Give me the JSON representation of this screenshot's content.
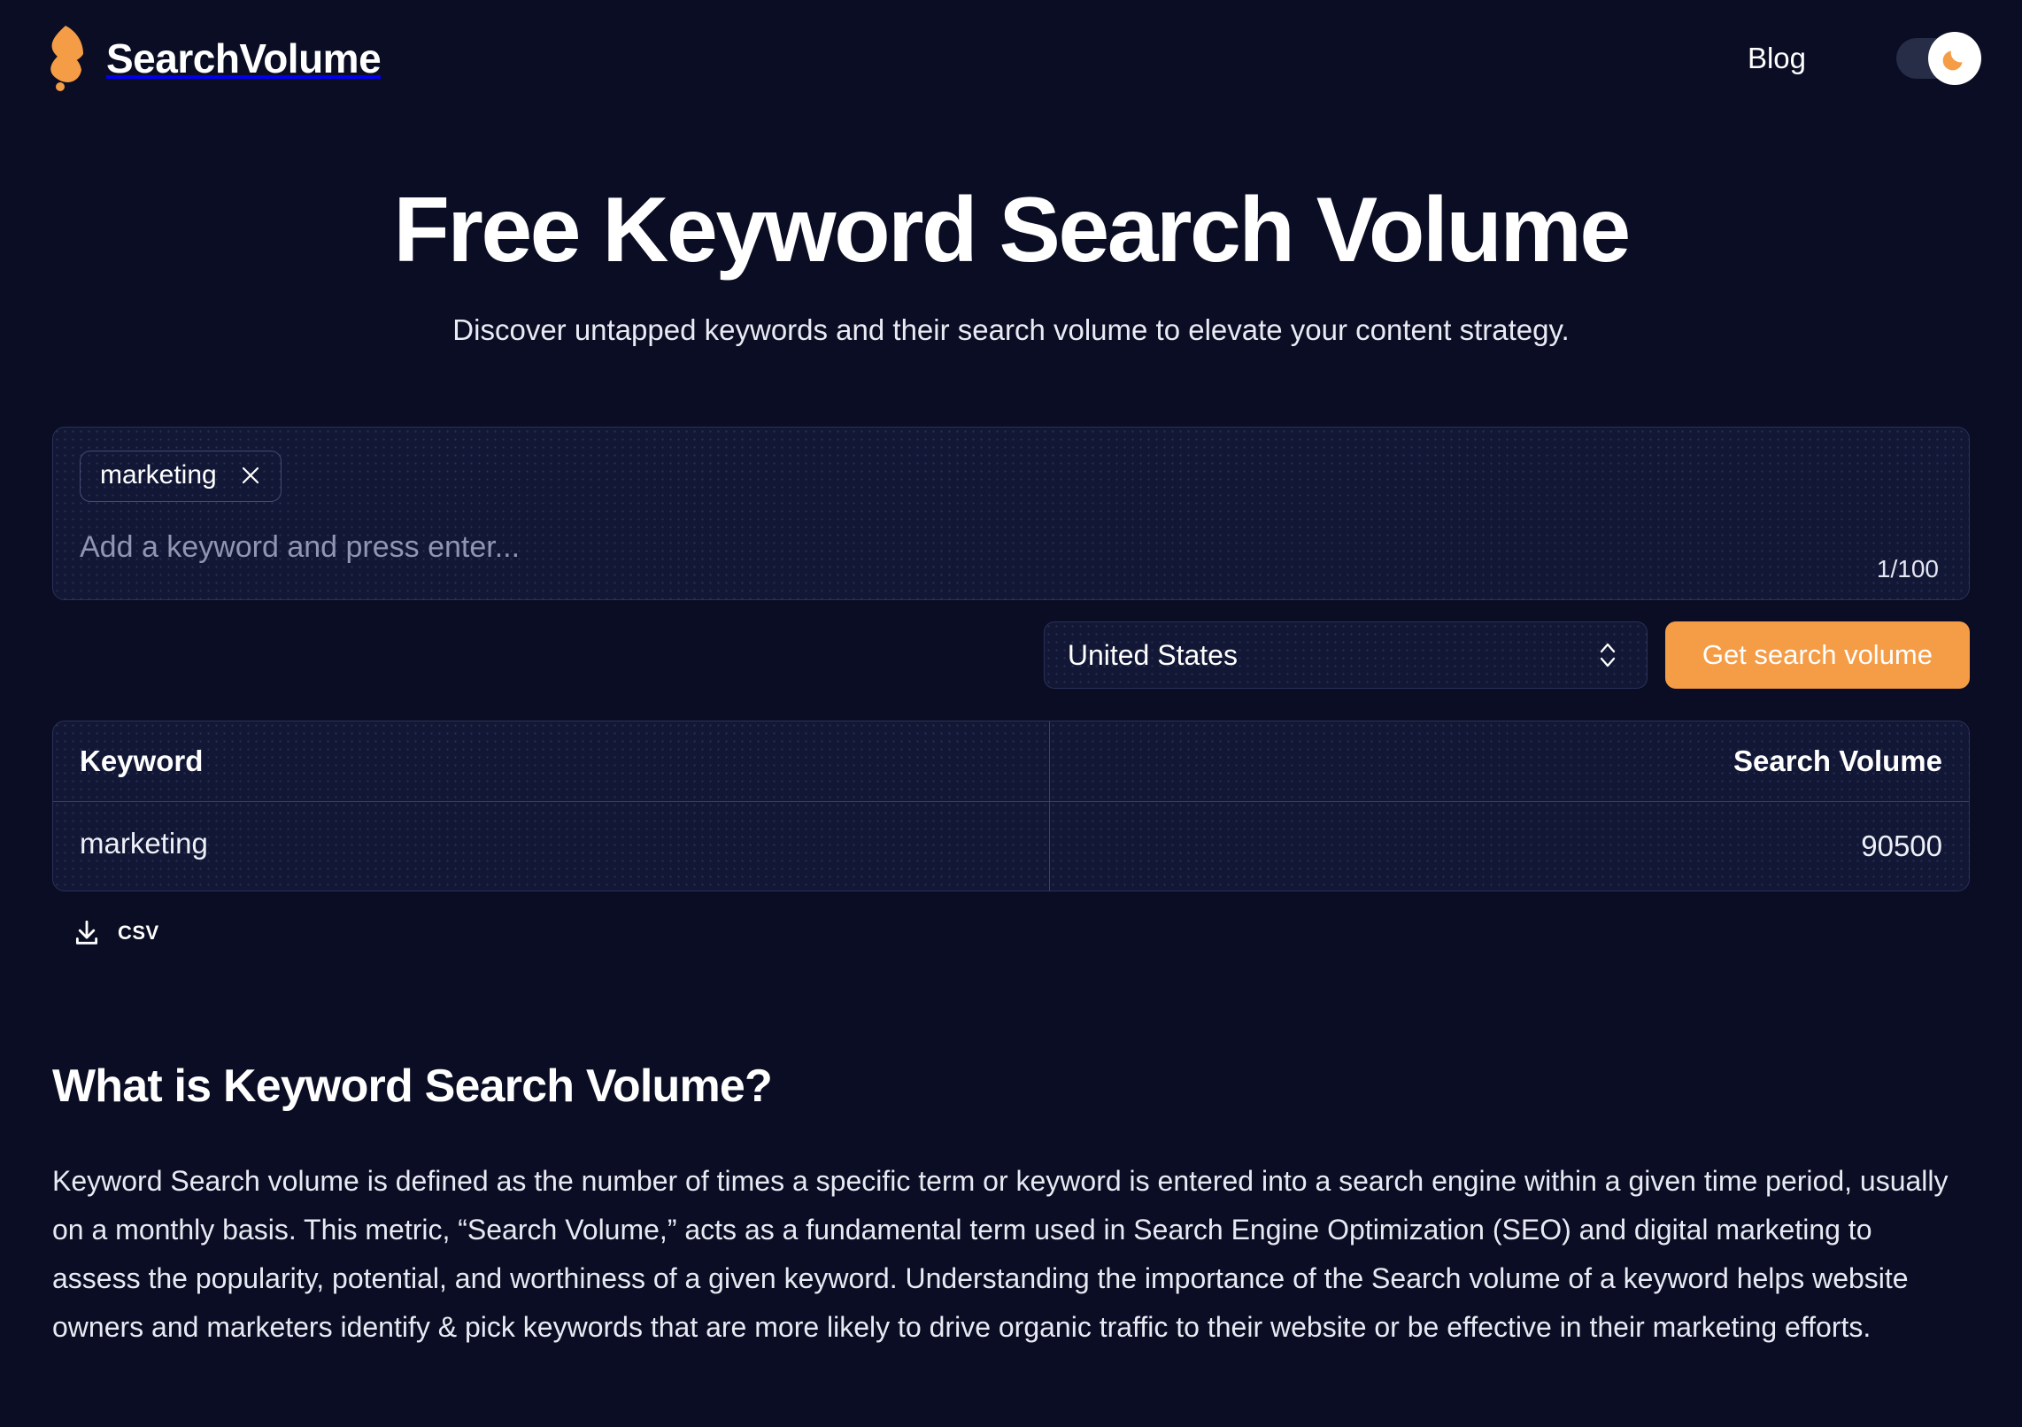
{
  "theme": {
    "background": "#0a0d23",
    "card_background": "#121735",
    "border": "#2b3158",
    "accent": "#f59c46",
    "text": "#ffffff"
  },
  "header": {
    "brand_name": "SearchVolume",
    "logo_icon": "flame-logo-icon",
    "nav": {
      "blog_label": "Blog"
    },
    "theme_toggle": {
      "icon": "moon-icon",
      "state": "dark"
    }
  },
  "hero": {
    "title": "Free Keyword Search Volume",
    "subtitle": "Discover untapped keywords and their search volume to elevate your content strategy."
  },
  "keyword_input": {
    "chips": [
      {
        "label": "marketing",
        "remove_icon": "close-icon"
      }
    ],
    "placeholder": "Add a keyword and press enter...",
    "value": "",
    "counter": "1/100"
  },
  "controls": {
    "country_select": {
      "selected": "United States",
      "chevron_icon": "chevron-up-down-icon"
    },
    "submit_label": "Get search volume"
  },
  "results": {
    "columns": [
      "Keyword",
      "Search Volume"
    ],
    "rows": [
      {
        "keyword": "marketing",
        "volume": "90500"
      }
    ],
    "download": {
      "icon": "download-icon",
      "label": "CSV"
    }
  },
  "article": {
    "heading": "What is Keyword Search Volume?",
    "body": "Keyword Search volume is defined as the number of times a specific term or keyword is entered into a search engine within a given time period, usually on a monthly basis. This metric, “Search Volume,” acts as a fundamental term used in Search Engine Optimization (SEO) and digital marketing to assess the popularity, potential, and worthiness of a given keyword. Understanding the importance of the Search volume of a keyword helps website owners and marketers identify & pick keywords that are more likely to drive organic traffic to their website or be effective in their marketing efforts."
  }
}
